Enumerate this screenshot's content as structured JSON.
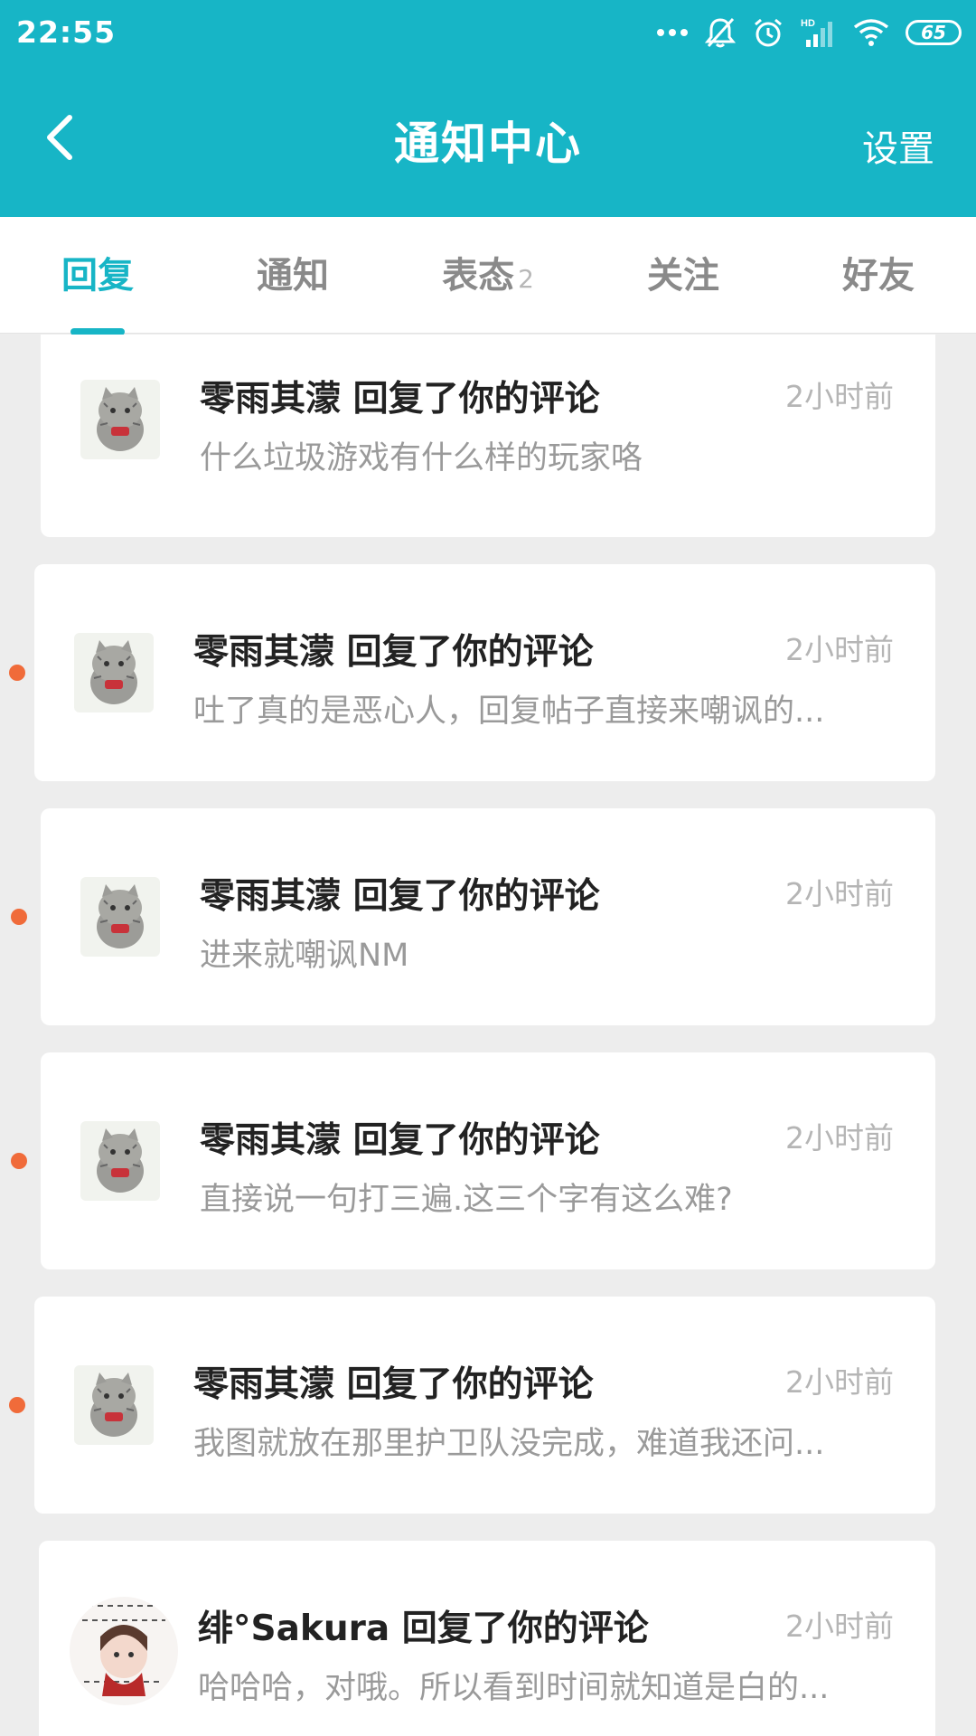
{
  "status_bar": {
    "time": "22:55",
    "battery": "65",
    "icons": [
      "dots-icon",
      "mute-bell-icon",
      "alarm-icon",
      "hd-signal-icon",
      "wifi-icon",
      "battery-icon"
    ]
  },
  "header": {
    "title": "通知中心",
    "settings_label": "设置",
    "back_icon": "chevron-left-icon"
  },
  "tabs": [
    {
      "label": "回复",
      "active": true
    },
    {
      "label": "通知",
      "active": false
    },
    {
      "label": "表态",
      "badge": "2",
      "active": false
    },
    {
      "label": "关注",
      "active": false
    },
    {
      "label": "好友",
      "active": false
    }
  ],
  "notifications": [
    {
      "title": "零雨其濛 回复了你的评论",
      "time": "2小时前",
      "preview": "什么垃圾游戏有什么样的玩家咯",
      "unread": false,
      "avatar": "cat-avatar"
    },
    {
      "title": "零雨其濛 回复了你的评论",
      "time": "2小时前",
      "preview": "吐了真的是恶心人，回复帖子直接来嘲讽的...",
      "unread": true,
      "avatar": "cat-avatar"
    },
    {
      "title": "零雨其濛 回复了你的评论",
      "time": "2小时前",
      "preview": "进来就嘲讽NM",
      "unread": true,
      "avatar": "cat-avatar"
    },
    {
      "title": "零雨其濛 回复了你的评论",
      "time": "2小时前",
      "preview": "直接说一句打三遍.这三个字有这么难?",
      "unread": true,
      "avatar": "cat-avatar"
    },
    {
      "title": "零雨其濛 回复了你的评论",
      "time": "2小时前",
      "preview": "我图就放在那里护卫队没完成，难道我还问...",
      "unread": true,
      "avatar": "cat-avatar"
    },
    {
      "title": "绯°Sakura 回复了你的评论",
      "time": "2小时前",
      "preview": "哈哈哈，对哦。所以看到时间就知道是白的...",
      "unread": false,
      "avatar": "girl-avatar"
    }
  ],
  "colors": {
    "accent": "#17b5c6",
    "unread_dot": "#f06b3a"
  }
}
